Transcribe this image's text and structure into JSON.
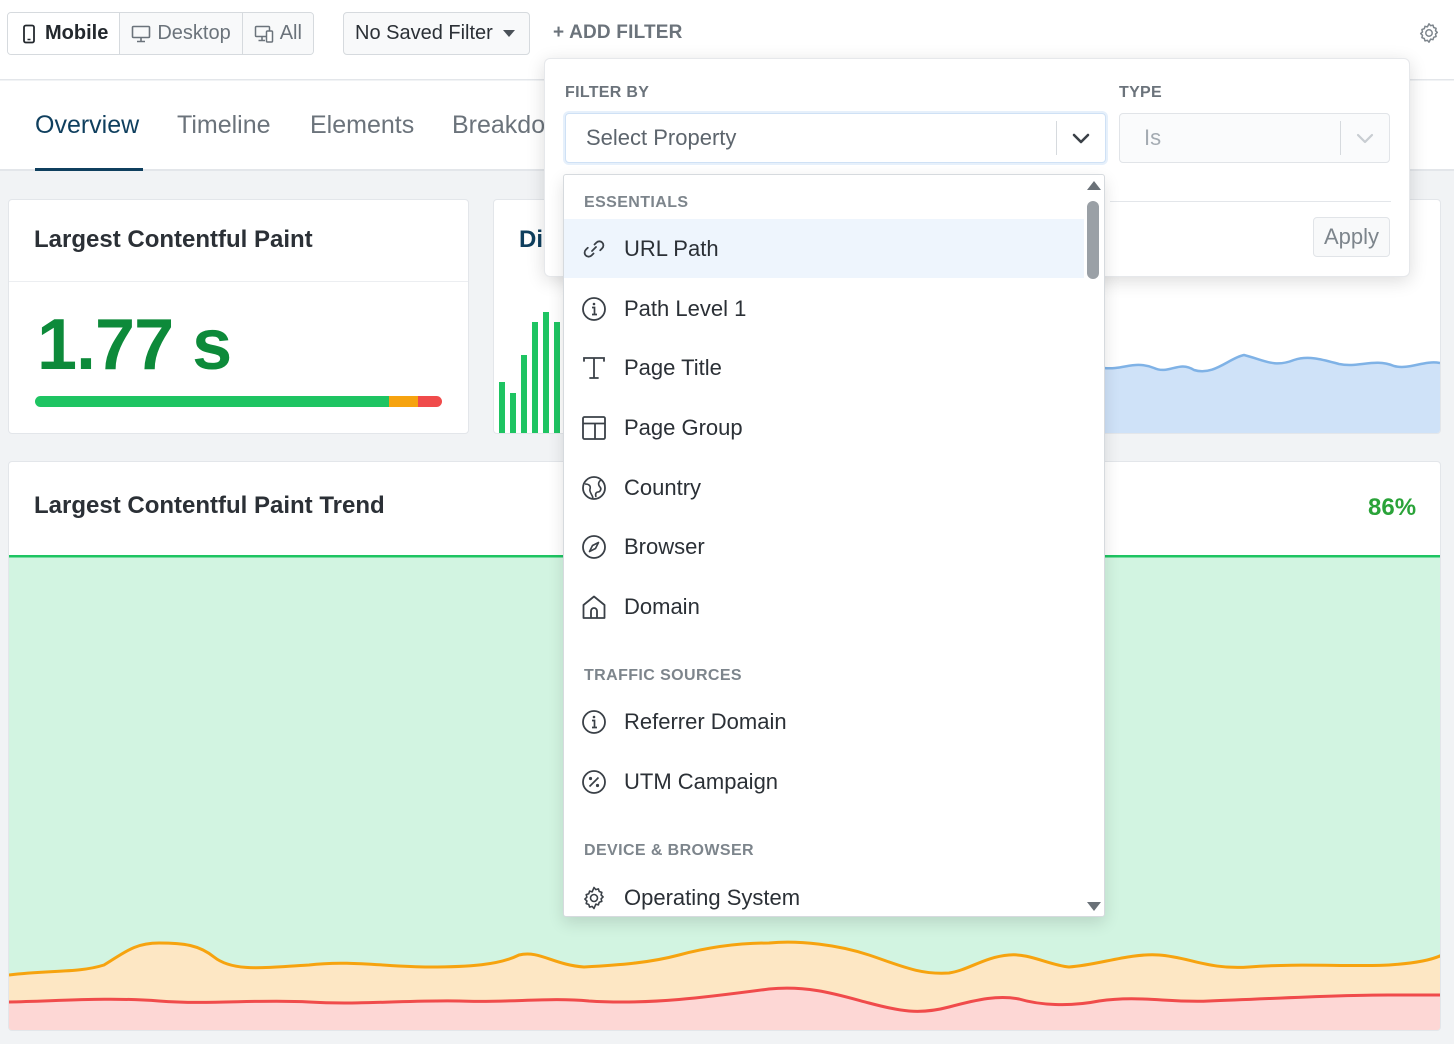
{
  "toolbar": {
    "device_tabs": [
      {
        "label": "Mobile",
        "icon": "mobile-icon",
        "active": true
      },
      {
        "label": "Desktop",
        "icon": "desktop-icon",
        "active": false
      },
      {
        "label": "All",
        "icon": "all-devices-icon",
        "active": false
      }
    ],
    "saved_filter_label": "No Saved Filter",
    "add_filter_label": "+ ADD FILTER",
    "settings_icon": "gear-icon"
  },
  "tabs": [
    {
      "label": "Overview",
      "active": true
    },
    {
      "label": "Timeline",
      "active": false
    },
    {
      "label": "Elements",
      "active": false
    },
    {
      "label": "Breakdo",
      "active": false
    }
  ],
  "lcp_card": {
    "title": "Largest Contentful Paint",
    "value": "1.77 s",
    "distribution": {
      "good": 0.87,
      "needs_improvement": 0.07,
      "poor": 0.06
    },
    "colors": {
      "good": "#1ec462",
      "needs_improvement": "#f6a30f",
      "poor": "#f04b4b"
    }
  },
  "distribution_card": {
    "title": "Di"
  },
  "trend_card": {
    "title": "Largest Contentful Paint Trend",
    "percent": "86%"
  },
  "filter_popover": {
    "filter_by_label": "FILTER BY",
    "type_label": "TYPE",
    "property_placeholder": "Select Property",
    "type_value": "Is",
    "apply_label": "Apply"
  },
  "property_dropdown": {
    "groups": [
      {
        "name": "ESSENTIALS",
        "items": [
          {
            "label": "URL Path",
            "icon": "link-icon",
            "highlighted": true
          },
          {
            "label": "Path Level 1",
            "icon": "info-icon"
          },
          {
            "label": "Page Title",
            "icon": "text-icon"
          },
          {
            "label": "Page Group",
            "icon": "layout-icon"
          },
          {
            "label": "Country",
            "icon": "globe-icon"
          },
          {
            "label": "Browser",
            "icon": "compass-icon"
          },
          {
            "label": "Domain",
            "icon": "home-icon"
          }
        ]
      },
      {
        "name": "TRAFFIC SOURCES",
        "items": [
          {
            "label": "Referrer Domain",
            "icon": "info-icon"
          },
          {
            "label": "UTM Campaign",
            "icon": "percent-icon"
          }
        ]
      },
      {
        "name": "DEVICE & BROWSER",
        "items": [
          {
            "label": "Operating System",
            "icon": "gear-icon"
          }
        ]
      }
    ]
  }
}
